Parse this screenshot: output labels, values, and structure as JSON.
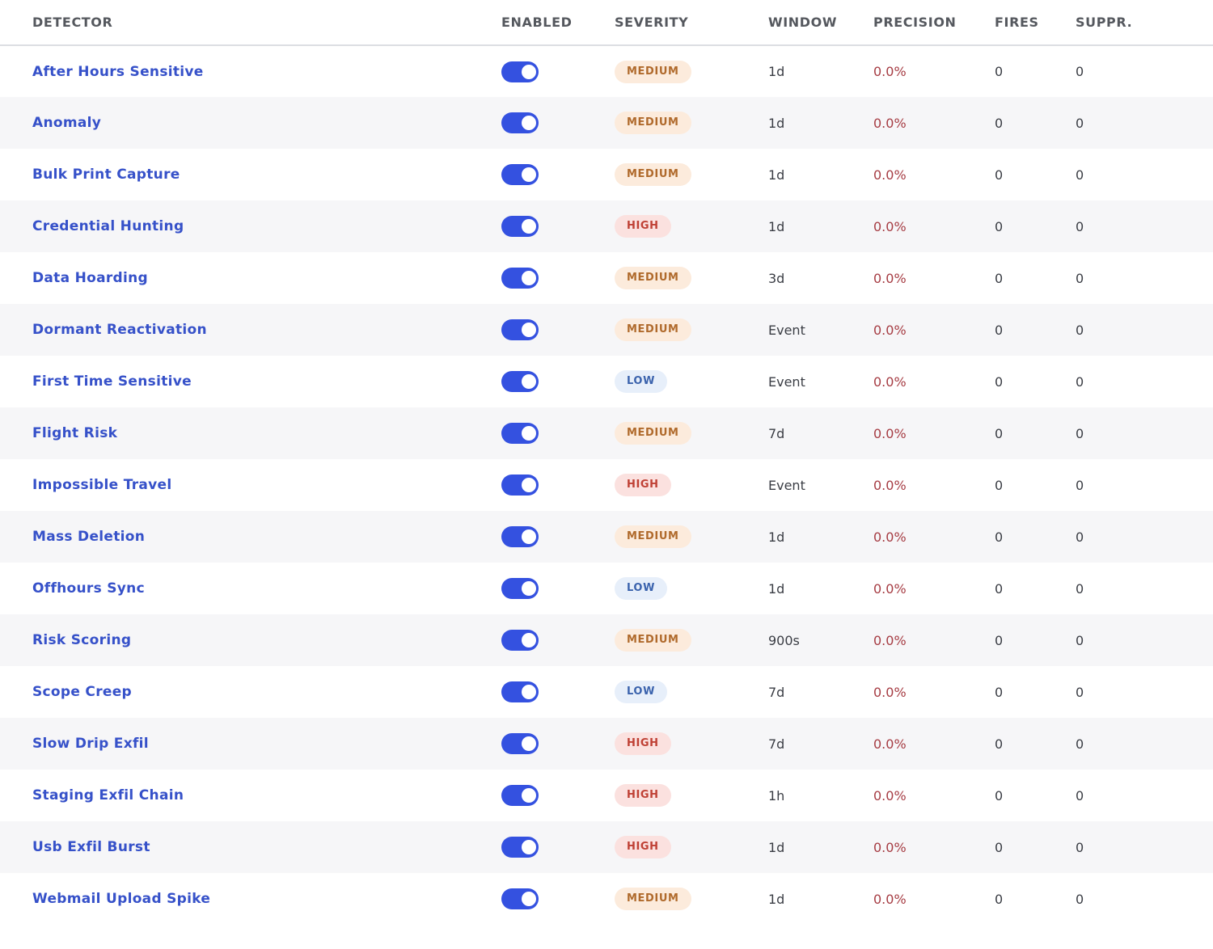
{
  "table": {
    "columns": {
      "detector": "DETECTOR",
      "enabled": "ENABLED",
      "severity": "SEVERITY",
      "window": "WINDOW",
      "precision": "PRECISION",
      "fires": "FIRES",
      "suppressed": "SUPPR."
    },
    "rows": [
      {
        "name": "After Hours Sensitive",
        "enabled": true,
        "severity": "MEDIUM",
        "window": "1d",
        "precision": "0.0%",
        "fires": "0",
        "suppressed": "0"
      },
      {
        "name": "Anomaly",
        "enabled": true,
        "severity": "MEDIUM",
        "window": "1d",
        "precision": "0.0%",
        "fires": "0",
        "suppressed": "0"
      },
      {
        "name": "Bulk Print Capture",
        "enabled": true,
        "severity": "MEDIUM",
        "window": "1d",
        "precision": "0.0%",
        "fires": "0",
        "suppressed": "0"
      },
      {
        "name": "Credential Hunting",
        "enabled": true,
        "severity": "HIGH",
        "window": "1d",
        "precision": "0.0%",
        "fires": "0",
        "suppressed": "0"
      },
      {
        "name": "Data Hoarding",
        "enabled": true,
        "severity": "MEDIUM",
        "window": "3d",
        "precision": "0.0%",
        "fires": "0",
        "suppressed": "0"
      },
      {
        "name": "Dormant Reactivation",
        "enabled": true,
        "severity": "MEDIUM",
        "window": "Event",
        "precision": "0.0%",
        "fires": "0",
        "suppressed": "0"
      },
      {
        "name": "First Time Sensitive",
        "enabled": true,
        "severity": "LOW",
        "window": "Event",
        "precision": "0.0%",
        "fires": "0",
        "suppressed": "0"
      },
      {
        "name": "Flight Risk",
        "enabled": true,
        "severity": "MEDIUM",
        "window": "7d",
        "precision": "0.0%",
        "fires": "0",
        "suppressed": "0"
      },
      {
        "name": "Impossible Travel",
        "enabled": true,
        "severity": "HIGH",
        "window": "Event",
        "precision": "0.0%",
        "fires": "0",
        "suppressed": "0"
      },
      {
        "name": "Mass Deletion",
        "enabled": true,
        "severity": "MEDIUM",
        "window": "1d",
        "precision": "0.0%",
        "fires": "0",
        "suppressed": "0"
      },
      {
        "name": "Offhours Sync",
        "enabled": true,
        "severity": "LOW",
        "window": "1d",
        "precision": "0.0%",
        "fires": "0",
        "suppressed": "0"
      },
      {
        "name": "Risk Scoring",
        "enabled": true,
        "severity": "MEDIUM",
        "window": "900s",
        "precision": "0.0%",
        "fires": "0",
        "suppressed": "0"
      },
      {
        "name": "Scope Creep",
        "enabled": true,
        "severity": "LOW",
        "window": "7d",
        "precision": "0.0%",
        "fires": "0",
        "suppressed": "0"
      },
      {
        "name": "Slow Drip Exfil",
        "enabled": true,
        "severity": "HIGH",
        "window": "7d",
        "precision": "0.0%",
        "fires": "0",
        "suppressed": "0"
      },
      {
        "name": "Staging Exfil Chain",
        "enabled": true,
        "severity": "HIGH",
        "window": "1h",
        "precision": "0.0%",
        "fires": "0",
        "suppressed": "0"
      },
      {
        "name": "Usb Exfil Burst",
        "enabled": true,
        "severity": "HIGH",
        "window": "1d",
        "precision": "0.0%",
        "fires": "0",
        "suppressed": "0"
      },
      {
        "name": "Webmail Upload Spike",
        "enabled": true,
        "severity": "MEDIUM",
        "window": "1d",
        "precision": "0.0%",
        "fires": "0",
        "suppressed": "0"
      }
    ]
  },
  "colors": {
    "accent": "#3451e0",
    "link": "#3651c9",
    "precision": "#a63c43",
    "severity_medium_bg": "#fcebdc",
    "severity_medium_text": "#b06a2c",
    "severity_high_bg": "#fbe1df",
    "severity_high_text": "#bf4034",
    "severity_low_bg": "#e7effa",
    "severity_low_text": "#3b63ad"
  }
}
